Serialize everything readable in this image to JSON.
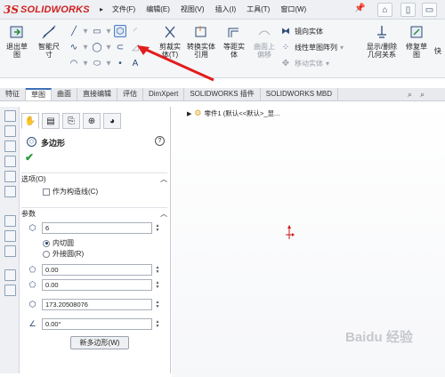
{
  "app": {
    "brand_prefix": "3S",
    "brand_name": "SOLIDWORKS"
  },
  "menu": [
    "文件(F)",
    "编辑(E)",
    "视图(V)",
    "插入(I)",
    "工具(T)",
    "窗口(W)"
  ],
  "cmd": {
    "exit_sketch": "退出草图",
    "smart_dim": "智能尺寸",
    "trim": "剪裁实体(T)",
    "convert": "转换实体引用",
    "offset": "等距实体",
    "surface_offset": "曲面上偏移",
    "mirror": "镜向实体",
    "linear_pattern": "线性草图阵列",
    "move": "移动实体",
    "display_relations": "显示/删除几何关系",
    "repair_sketch": "修复草图",
    "quick": "快"
  },
  "tabs": [
    "特征",
    "草图",
    "曲面",
    "直接编辑",
    "评估",
    "DimXpert",
    "SOLIDWORKS 插件",
    "SOLIDWORKS MBD"
  ],
  "active_tab": "草图",
  "property_manager": {
    "title": "多边形",
    "options_label": "选项(O)",
    "construction_label": "作为构造线(C)",
    "params_label": "参数",
    "sides": "6",
    "inscribed": "内切圆",
    "circumscribed": "外接圆(R)",
    "x": "0.00",
    "y": "0.00",
    "diameter": "173.20508076",
    "angle": "0.00°",
    "new_polygon": "新多边形(W)",
    "help": "?"
  },
  "tree": {
    "part": "零件1 (默认<<默认>_显..."
  },
  "watermark": "Baidu 经验",
  "colors": {
    "brand_red": "#d02020",
    "accent_blue": "#3b6fb6",
    "origin_red": "#d01818"
  }
}
